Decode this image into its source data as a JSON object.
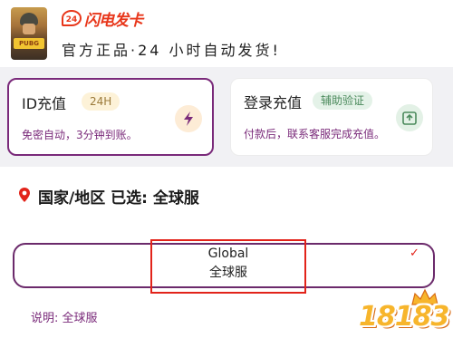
{
  "header": {
    "logo_mark": "24",
    "logo_text": "闪电发卡",
    "tagline": "官方正品·24 小时自动发货!"
  },
  "cards": {
    "id_recharge": {
      "title": "ID充值",
      "tag": "24H",
      "desc": "免密自动，3分钟到账。",
      "icon": "lightning-icon"
    },
    "login_recharge": {
      "title": "登录充值",
      "tag": "辅助验证",
      "desc": "付款后，联系客服完成充值。",
      "icon": "share-box-icon"
    }
  },
  "region": {
    "title": "国家/地区 已选: 全球服",
    "icon": "location-pin-icon",
    "option_line1": "Global",
    "option_line2": "全球服",
    "note": "说明: 全球服"
  },
  "watermark": {
    "text": "18183"
  },
  "colors": {
    "accent_purple": "#7a2a7a",
    "highlight_red": "#e2231a",
    "brand_red": "#e8361a",
    "watermark_orange": "#f7b52c"
  }
}
